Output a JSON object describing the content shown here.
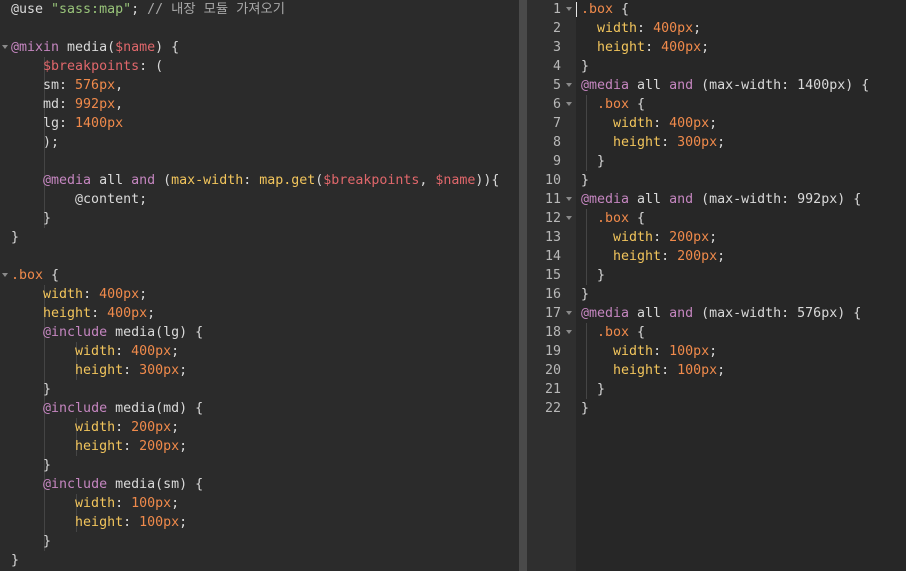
{
  "left_editor": {
    "lines": [
      [
        {
          "t": "@use ",
          "c": "pl"
        },
        {
          "t": "\"sass:map\"",
          "c": "str"
        },
        {
          "t": "; ",
          "c": "pl"
        },
        {
          "t": "// 내장 모듈 가져오기",
          "c": "cm"
        }
      ],
      [],
      [
        {
          "t": "@mixin ",
          "c": "at"
        },
        {
          "t": "media(",
          "c": "pl"
        },
        {
          "t": "$name",
          "c": "var"
        },
        {
          "t": ") {",
          "c": "pl"
        }
      ],
      [
        {
          "t": "    ",
          "c": "pl"
        },
        {
          "t": "$breakpoints",
          "c": "var"
        },
        {
          "t": ": (",
          "c": "pl"
        }
      ],
      [
        {
          "t": "    sm: ",
          "c": "pl"
        },
        {
          "t": "576px",
          "c": "num"
        },
        {
          "t": ",",
          "c": "pl"
        }
      ],
      [
        {
          "t": "    md: ",
          "c": "pl"
        },
        {
          "t": "992px",
          "c": "num"
        },
        {
          "t": ",",
          "c": "pl"
        }
      ],
      [
        {
          "t": "    lg: ",
          "c": "pl"
        },
        {
          "t": "1400px",
          "c": "num"
        }
      ],
      [
        {
          "t": "    );",
          "c": "pl"
        }
      ],
      [],
      [
        {
          "t": "    ",
          "c": "pl"
        },
        {
          "t": "@media ",
          "c": "at"
        },
        {
          "t": "all ",
          "c": "pl"
        },
        {
          "t": "and ",
          "c": "kw"
        },
        {
          "t": "(",
          "c": "pl"
        },
        {
          "t": "max-width",
          "c": "prop"
        },
        {
          "t": ": ",
          "c": "pl"
        },
        {
          "t": "map.get",
          "c": "prop"
        },
        {
          "t": "(",
          "c": "pl"
        },
        {
          "t": "$breakpoints",
          "c": "var"
        },
        {
          "t": ", ",
          "c": "pl"
        },
        {
          "t": "$name",
          "c": "var"
        },
        {
          "t": ")){",
          "c": "pl"
        }
      ],
      [
        {
          "t": "        @content;",
          "c": "pl"
        }
      ],
      [
        {
          "t": "    }",
          "c": "pl"
        }
      ],
      [
        {
          "t": "}",
          "c": "pl"
        }
      ],
      [],
      [
        {
          "t": ".box",
          "c": "sel"
        },
        {
          "t": " {",
          "c": "pl"
        }
      ],
      [
        {
          "t": "    ",
          "c": "pl"
        },
        {
          "t": "width",
          "c": "prop"
        },
        {
          "t": ": ",
          "c": "pl"
        },
        {
          "t": "400px",
          "c": "num"
        },
        {
          "t": ";",
          "c": "pl"
        }
      ],
      [
        {
          "t": "    ",
          "c": "pl"
        },
        {
          "t": "height",
          "c": "prop"
        },
        {
          "t": ": ",
          "c": "pl"
        },
        {
          "t": "400px",
          "c": "num"
        },
        {
          "t": ";",
          "c": "pl"
        }
      ],
      [
        {
          "t": "    ",
          "c": "pl"
        },
        {
          "t": "@include ",
          "c": "at"
        },
        {
          "t": "media(lg) {",
          "c": "pl"
        }
      ],
      [
        {
          "t": "        ",
          "c": "pl"
        },
        {
          "t": "width",
          "c": "prop"
        },
        {
          "t": ": ",
          "c": "pl"
        },
        {
          "t": "400px",
          "c": "num"
        },
        {
          "t": ";",
          "c": "pl"
        }
      ],
      [
        {
          "t": "        ",
          "c": "pl"
        },
        {
          "t": "height",
          "c": "prop"
        },
        {
          "t": ": ",
          "c": "pl"
        },
        {
          "t": "300px",
          "c": "num"
        },
        {
          "t": ";",
          "c": "pl"
        }
      ],
      [
        {
          "t": "    }",
          "c": "pl"
        }
      ],
      [
        {
          "t": "    ",
          "c": "pl"
        },
        {
          "t": "@include ",
          "c": "at"
        },
        {
          "t": "media(md) {",
          "c": "pl"
        }
      ],
      [
        {
          "t": "        ",
          "c": "pl"
        },
        {
          "t": "width",
          "c": "prop"
        },
        {
          "t": ": ",
          "c": "pl"
        },
        {
          "t": "200px",
          "c": "num"
        },
        {
          "t": ";",
          "c": "pl"
        }
      ],
      [
        {
          "t": "        ",
          "c": "pl"
        },
        {
          "t": "height",
          "c": "prop"
        },
        {
          "t": ": ",
          "c": "pl"
        },
        {
          "t": "200px",
          "c": "num"
        },
        {
          "t": ";",
          "c": "pl"
        }
      ],
      [
        {
          "t": "    }",
          "c": "pl"
        }
      ],
      [
        {
          "t": "    ",
          "c": "pl"
        },
        {
          "t": "@include ",
          "c": "at"
        },
        {
          "t": "media(sm) {",
          "c": "pl"
        }
      ],
      [
        {
          "t": "        ",
          "c": "pl"
        },
        {
          "t": "width",
          "c": "prop"
        },
        {
          "t": ": ",
          "c": "pl"
        },
        {
          "t": "100px",
          "c": "num"
        },
        {
          "t": ";",
          "c": "pl"
        }
      ],
      [
        {
          "t": "        ",
          "c": "pl"
        },
        {
          "t": "height",
          "c": "prop"
        },
        {
          "t": ": ",
          "c": "pl"
        },
        {
          "t": "100px",
          "c": "num"
        },
        {
          "t": ";",
          "c": "pl"
        }
      ],
      [
        {
          "t": "    }",
          "c": "pl"
        }
      ],
      [
        {
          "t": "}",
          "c": "pl"
        }
      ]
    ],
    "fold_lines": [
      3,
      15
    ]
  },
  "right_editor": {
    "line_numbers": [
      "1",
      "2",
      "3",
      "4",
      "5",
      "6",
      "7",
      "8",
      "9",
      "10",
      "11",
      "12",
      "13",
      "14",
      "15",
      "16",
      "17",
      "18",
      "19",
      "20",
      "21",
      "22"
    ],
    "lines": [
      [
        {
          "t": ".box",
          "c": "sel"
        },
        {
          "t": " {",
          "c": "pl"
        }
      ],
      [
        {
          "t": "  ",
          "c": "pl"
        },
        {
          "t": "width",
          "c": "prop"
        },
        {
          "t": ": ",
          "c": "pl"
        },
        {
          "t": "400px",
          "c": "num"
        },
        {
          "t": ";",
          "c": "pl"
        }
      ],
      [
        {
          "t": "  ",
          "c": "pl"
        },
        {
          "t": "height",
          "c": "prop"
        },
        {
          "t": ": ",
          "c": "pl"
        },
        {
          "t": "400px",
          "c": "num"
        },
        {
          "t": ";",
          "c": "pl"
        }
      ],
      [
        {
          "t": "}",
          "c": "pl"
        }
      ],
      [
        {
          "t": "@media ",
          "c": "at"
        },
        {
          "t": "all ",
          "c": "pl"
        },
        {
          "t": "and ",
          "c": "kw"
        },
        {
          "t": "(max-width: 1400px) {",
          "c": "pl"
        }
      ],
      [
        {
          "t": "  ",
          "c": "pl"
        },
        {
          "t": ".box",
          "c": "sel"
        },
        {
          "t": " {",
          "c": "pl"
        }
      ],
      [
        {
          "t": "    ",
          "c": "pl"
        },
        {
          "t": "width",
          "c": "prop"
        },
        {
          "t": ": ",
          "c": "pl"
        },
        {
          "t": "400px",
          "c": "num"
        },
        {
          "t": ";",
          "c": "pl"
        }
      ],
      [
        {
          "t": "    ",
          "c": "pl"
        },
        {
          "t": "height",
          "c": "prop"
        },
        {
          "t": ": ",
          "c": "pl"
        },
        {
          "t": "300px",
          "c": "num"
        },
        {
          "t": ";",
          "c": "pl"
        }
      ],
      [
        {
          "t": "  }",
          "c": "pl"
        }
      ],
      [
        {
          "t": "}",
          "c": "pl"
        }
      ],
      [
        {
          "t": "@media ",
          "c": "at"
        },
        {
          "t": "all ",
          "c": "pl"
        },
        {
          "t": "and ",
          "c": "kw"
        },
        {
          "t": "(max-width: 992px) {",
          "c": "pl"
        }
      ],
      [
        {
          "t": "  ",
          "c": "pl"
        },
        {
          "t": ".box",
          "c": "sel"
        },
        {
          "t": " {",
          "c": "pl"
        }
      ],
      [
        {
          "t": "    ",
          "c": "pl"
        },
        {
          "t": "width",
          "c": "prop"
        },
        {
          "t": ": ",
          "c": "pl"
        },
        {
          "t": "200px",
          "c": "num"
        },
        {
          "t": ";",
          "c": "pl"
        }
      ],
      [
        {
          "t": "    ",
          "c": "pl"
        },
        {
          "t": "height",
          "c": "prop"
        },
        {
          "t": ": ",
          "c": "pl"
        },
        {
          "t": "200px",
          "c": "num"
        },
        {
          "t": ";",
          "c": "pl"
        }
      ],
      [
        {
          "t": "  }",
          "c": "pl"
        }
      ],
      [
        {
          "t": "}",
          "c": "pl"
        }
      ],
      [
        {
          "t": "@media ",
          "c": "at"
        },
        {
          "t": "all ",
          "c": "pl"
        },
        {
          "t": "and ",
          "c": "kw"
        },
        {
          "t": "(max-width: 576px) {",
          "c": "pl"
        }
      ],
      [
        {
          "t": "  ",
          "c": "pl"
        },
        {
          "t": ".box",
          "c": "sel"
        },
        {
          "t": " {",
          "c": "pl"
        }
      ],
      [
        {
          "t": "    ",
          "c": "pl"
        },
        {
          "t": "width",
          "c": "prop"
        },
        {
          "t": ": ",
          "c": "pl"
        },
        {
          "t": "100px",
          "c": "num"
        },
        {
          "t": ";",
          "c": "pl"
        }
      ],
      [
        {
          "t": "    ",
          "c": "pl"
        },
        {
          "t": "height",
          "c": "prop"
        },
        {
          "t": ": ",
          "c": "pl"
        },
        {
          "t": "100px",
          "c": "num"
        },
        {
          "t": ";",
          "c": "pl"
        }
      ],
      [
        {
          "t": "  }",
          "c": "pl"
        }
      ],
      [
        {
          "t": "}",
          "c": "pl"
        }
      ]
    ],
    "fold_lines": [
      1,
      5,
      6,
      11,
      12,
      17,
      18
    ]
  }
}
